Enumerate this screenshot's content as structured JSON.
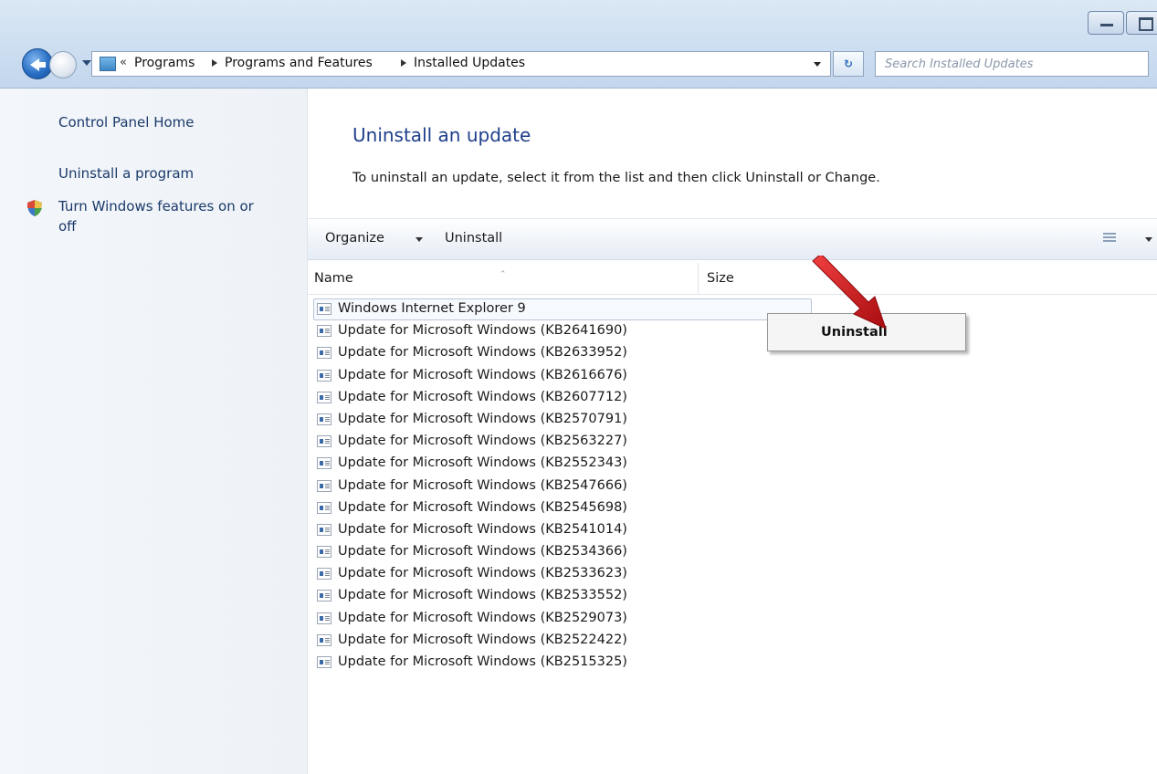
{
  "addressbar": {
    "overflow": "«",
    "crumbs": [
      "Programs",
      "Programs and Features",
      "Installed Updates"
    ]
  },
  "search": {
    "placeholder": "Search Installed Updates"
  },
  "leftpane": {
    "links": [
      "Control Panel Home",
      "Uninstall a program",
      "Turn Windows features on or",
      "off"
    ]
  },
  "main": {
    "heading": "Uninstall an update",
    "instruction": "To uninstall an update, select it from the list and then click Uninstall or Change."
  },
  "cmdbar": {
    "organize": "Organize",
    "uninstall": "Uninstall"
  },
  "columns": {
    "name": "Name",
    "size": "Size"
  },
  "updates": [
    "Windows Internet Explorer 9",
    "Update for Microsoft Windows (KB2641690)",
    "Update for Microsoft Windows (KB2633952)",
    "Update for Microsoft Windows (KB2616676)",
    "Update for Microsoft Windows (KB2607712)",
    "Update for Microsoft Windows (KB2570791)",
    "Update for Microsoft Windows (KB2563227)",
    "Update for Microsoft Windows (KB2552343)",
    "Update for Microsoft Windows (KB2547666)",
    "Update for Microsoft Windows (KB2545698)",
    "Update for Microsoft Windows (KB2541014)",
    "Update for Microsoft Windows (KB2534366)",
    "Update for Microsoft Windows (KB2533623)",
    "Update for Microsoft Windows (KB2533552)",
    "Update for Microsoft Windows (KB2529073)",
    "Update for Microsoft Windows (KB2522422)",
    "Update for Microsoft Windows (KB2515325)"
  ],
  "context_menu": {
    "uninstall": "Uninstall"
  },
  "colors": {
    "heading": "#1e3f8a",
    "link": "#1a3a6a",
    "annotation_arrow": "#d0141a"
  }
}
